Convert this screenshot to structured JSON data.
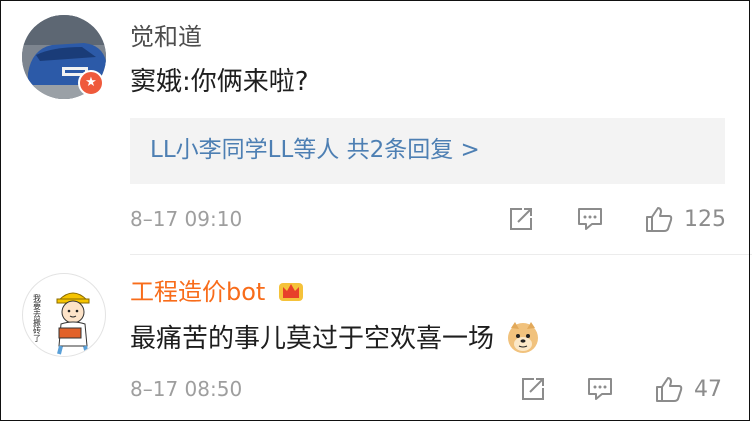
{
  "comments": [
    {
      "username": "觉和道",
      "text": "窦娥:你俩来啦?",
      "reply_summary": "LL小李同学LL等人  共2条回复 >",
      "timestamp": "8–17 09:10",
      "likes": "125",
      "avatar": "car-photo",
      "badge_icon": "verified-star-icon",
      "username_color": "#4d4d4d"
    },
    {
      "username": "工程造价bot",
      "text": "最痛苦的事儿莫过于空欢喜一场",
      "timestamp": "8–17 08:50",
      "likes": "47",
      "avatar": "cartoon-worker",
      "avatar_text": "我要去搬砖了",
      "username_icon": "crown-icon",
      "emoji_icon": "doge-icon",
      "username_color": "#f86c1a"
    }
  ],
  "colors": {
    "link": "#4d7fb3",
    "meta": "#9e9e9e",
    "reply_bg": "#f3f3f3",
    "badge": "#ef5a3c"
  }
}
